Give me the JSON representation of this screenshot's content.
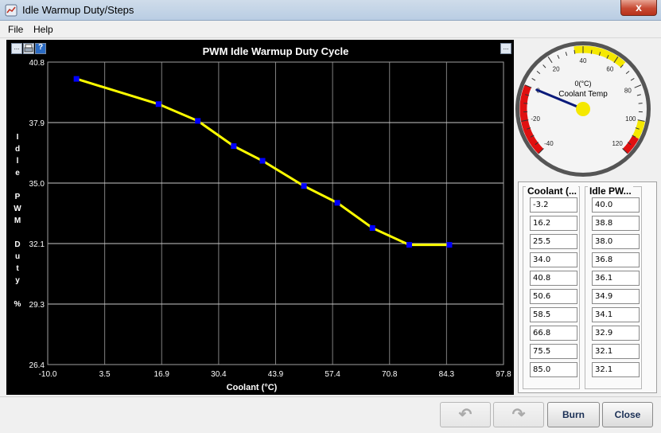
{
  "window": {
    "title": "Idle Warmup Duty/Steps",
    "close_glyph": "x"
  },
  "menu": {
    "file": "File",
    "help": "Help"
  },
  "toolbar": {
    "more_label": "...",
    "help_label": "?"
  },
  "chart_data": {
    "type": "line",
    "title": "PWM Idle Warmup Duty Cycle",
    "xlabel": "Coolant (°C)",
    "ylabel": "I d l e   P W M   D u t y   %",
    "x_ticks": [
      "-10.0",
      "3.5",
      "16.9",
      "30.4",
      "43.9",
      "57.4",
      "70.8",
      "84.3",
      "97.8"
    ],
    "y_ticks": [
      "40.8",
      "37.9",
      "35.0",
      "32.1",
      "29.3",
      "26.4"
    ],
    "xlim": [
      -10.0,
      97.8
    ],
    "ylim": [
      26.4,
      40.8
    ],
    "x": [
      -3.2,
      16.2,
      25.5,
      34.0,
      40.8,
      50.6,
      58.5,
      66.8,
      75.5,
      85.0
    ],
    "y": [
      40.0,
      38.8,
      38.0,
      36.8,
      36.1,
      34.9,
      34.1,
      32.9,
      32.1,
      32.1
    ],
    "line_color": "#ffff00",
    "point_color": "#0000ff",
    "grid": true
  },
  "gauge": {
    "title": "Coolant Temp",
    "unit": "0(°C)",
    "value": 0,
    "ticks": [
      "-40",
      "-20",
      "0",
      "20",
      "40",
      "60",
      "80",
      "100",
      "120"
    ]
  },
  "table": {
    "col1_header": "Coolant (...",
    "col2_header": "Idle PW...",
    "rows": [
      [
        "-3.2",
        "40.0"
      ],
      [
        "16.2",
        "38.8"
      ],
      [
        "25.5",
        "38.0"
      ],
      [
        "34.0",
        "36.8"
      ],
      [
        "40.8",
        "36.1"
      ],
      [
        "50.6",
        "34.9"
      ],
      [
        "58.5",
        "34.1"
      ],
      [
        "66.8",
        "32.9"
      ],
      [
        "75.5",
        "32.1"
      ],
      [
        "85.0",
        "32.1"
      ]
    ]
  },
  "buttons": {
    "undo": "↶",
    "redo": "↷",
    "burn": "Burn",
    "close": "Close"
  }
}
